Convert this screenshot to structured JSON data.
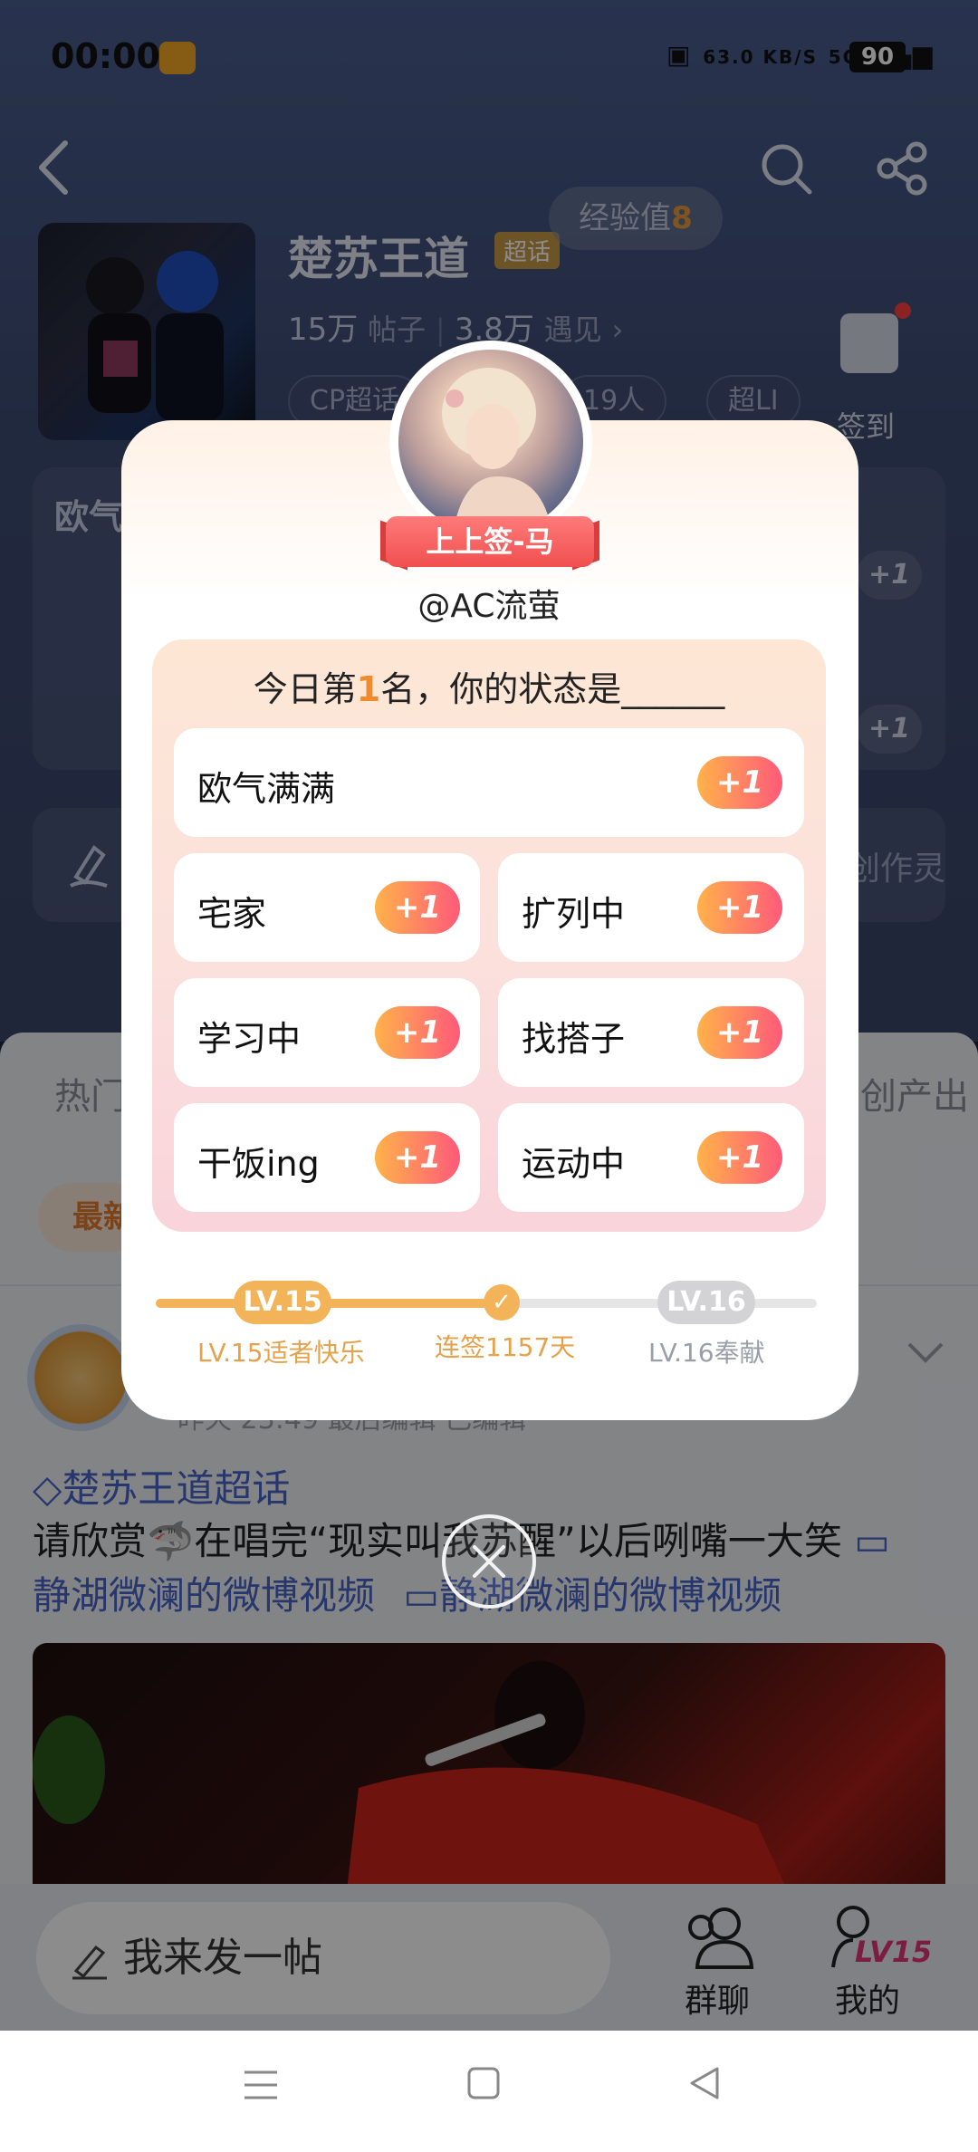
{
  "status_bar": {
    "time": "00:00",
    "speed": "63.0\nKB/S",
    "network": "5G",
    "battery": "90"
  },
  "topic": {
    "title": "楚苏王道",
    "tag": "超话",
    "experience_label": "经验值",
    "experience_value": "8",
    "posts_count": "15万",
    "posts_label": "帖子",
    "meet_count": "3.8万",
    "meet_label": "遇见",
    "chips": [
      "CP超话",
      "19人",
      "超LI"
    ],
    "signin_label": "签到"
  },
  "background_cards": {
    "card1_title": "欧气",
    "plus_labels": [
      "+1",
      "+1"
    ],
    "create_label": "创作灵"
  },
  "tabs": {
    "left": "热门",
    "right": "创产出"
  },
  "latest_label": "最新",
  "post": {
    "meta": "昨天 23:49 最后编辑 已编辑",
    "topic_tag": "楚苏王道超话",
    "text_before": "请欣赏🦈在唱完“现实叫我苏醒”以后咧嘴一大笑",
    "link1": "静湖微澜的微博视频",
    "link2": "静湖微澜的微博视频"
  },
  "bottom_bar": {
    "compose_placeholder": "我来发一帖",
    "group_chat": "群聊",
    "mine": "我的",
    "mine_level": "LV15"
  },
  "modal": {
    "fortune": "上上签-马",
    "username": "@AC流萤",
    "question_prefix": "今日第",
    "rank": "1",
    "question_suffix": "名，你的状态是______",
    "options": [
      {
        "label": "欧气满满",
        "plus": "+1"
      },
      {
        "label": "宅家",
        "plus": "+1"
      },
      {
        "label": "扩列中",
        "plus": "+1"
      },
      {
        "label": "学习中",
        "plus": "+1"
      },
      {
        "label": "找搭子",
        "plus": "+1"
      },
      {
        "label": "干饭ing",
        "plus": "+1"
      },
      {
        "label": "运动中",
        "plus": "+1"
      }
    ],
    "level_current": "LV.15",
    "level_next": "LV.16",
    "level_current_label": "LV.15适者快乐",
    "streak_label": "连签1157天",
    "level_next_label": "LV.16奉献"
  },
  "colors": {
    "accent_orange": "#f08a2e",
    "link_blue": "#4763c6",
    "plus_gradient_start": "#ffb24a",
    "plus_gradient_end": "#ff5a7a"
  }
}
